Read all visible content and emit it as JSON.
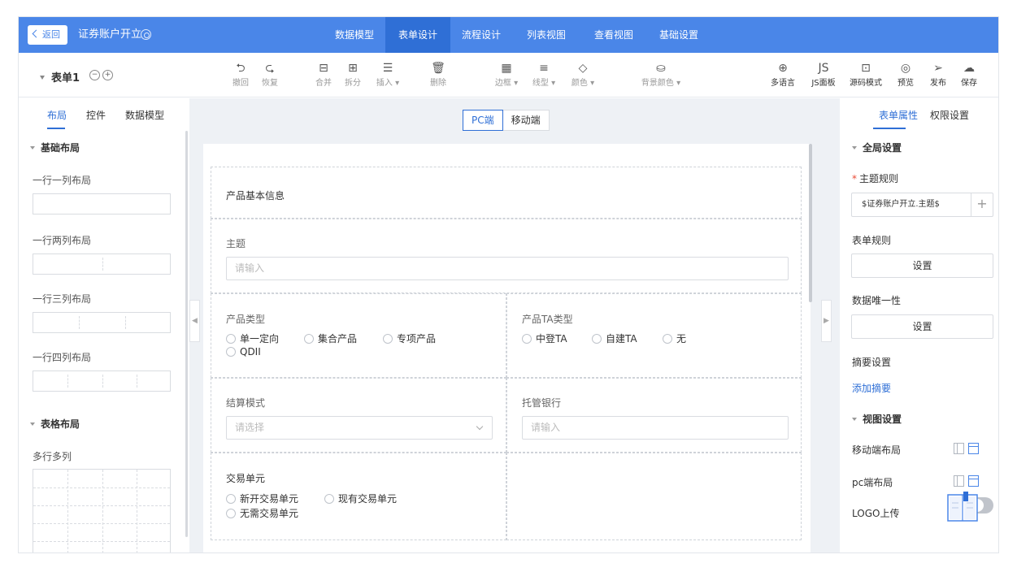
{
  "topbar": {
    "back_label": "返回",
    "app_title": "证券账户开立",
    "nav_tabs": [
      "数据模型",
      "表单设计",
      "流程设计",
      "列表视图",
      "查看视图",
      "基础设置"
    ],
    "active_tab": "表单设计",
    "colors": {
      "bar": "#4a86e8",
      "active": "#2f6fd6"
    }
  },
  "toolbar": {
    "form_name": "表单1",
    "tools": {
      "undo": "撤回",
      "redo": "恢复",
      "merge": "合并",
      "split": "拆分",
      "insert": "插入",
      "delete": "删除",
      "border": "边框",
      "line_type": "线型",
      "color": "颜色",
      "bg_color": "背景颜色",
      "multilang": "多语言",
      "js_panel": "JS面板",
      "source": "源码模式",
      "preview": "预览",
      "publish": "发布",
      "save": "保存"
    }
  },
  "left": {
    "tabs": [
      "布局",
      "控件",
      "数据模型"
    ],
    "basic_title": "基础布局",
    "layouts": [
      "一行一列布局",
      "一行两列布局",
      "一行三列布局",
      "一行四列布局"
    ],
    "table_title": "表格布局",
    "table_layout": "多行多列"
  },
  "center": {
    "device": {
      "pc": "PC端",
      "mobile": "移动端"
    },
    "form": {
      "section_title": "产品基本信息",
      "subject": {
        "label": "主题",
        "placeholder": "请输入"
      },
      "product_type": {
        "label": "产品类型",
        "options": [
          "单一定向",
          "集合产品",
          "专项产品",
          "QDII"
        ]
      },
      "ta_type": {
        "label": "产品TA类型",
        "options": [
          "中登TA",
          "自建TA",
          "无"
        ]
      },
      "settle": {
        "label": "结算模式",
        "placeholder": "请选择"
      },
      "bank": {
        "label": "托管银行",
        "placeholder": "请输入"
      },
      "trade_unit": {
        "label": "交易单元",
        "options": [
          "新开交易单元",
          "现有交易单元",
          "无需交易单元"
        ]
      }
    }
  },
  "right": {
    "tabs": [
      "表单属性",
      "权限设置"
    ],
    "global_title": "全局设置",
    "theme_rule_label": "主题规则",
    "theme_rule_value": "$证券账户开立.主题$",
    "form_rule_label": "表单规则",
    "set_label": "设置",
    "unique_label": "数据唯一性",
    "summary_label": "摘要设置",
    "add_summary": "添加摘要",
    "view_title": "视图设置",
    "mobile_layout": "移动端布局",
    "pc_layout": "pc端布局",
    "logo_upload": "LOGO上传"
  }
}
